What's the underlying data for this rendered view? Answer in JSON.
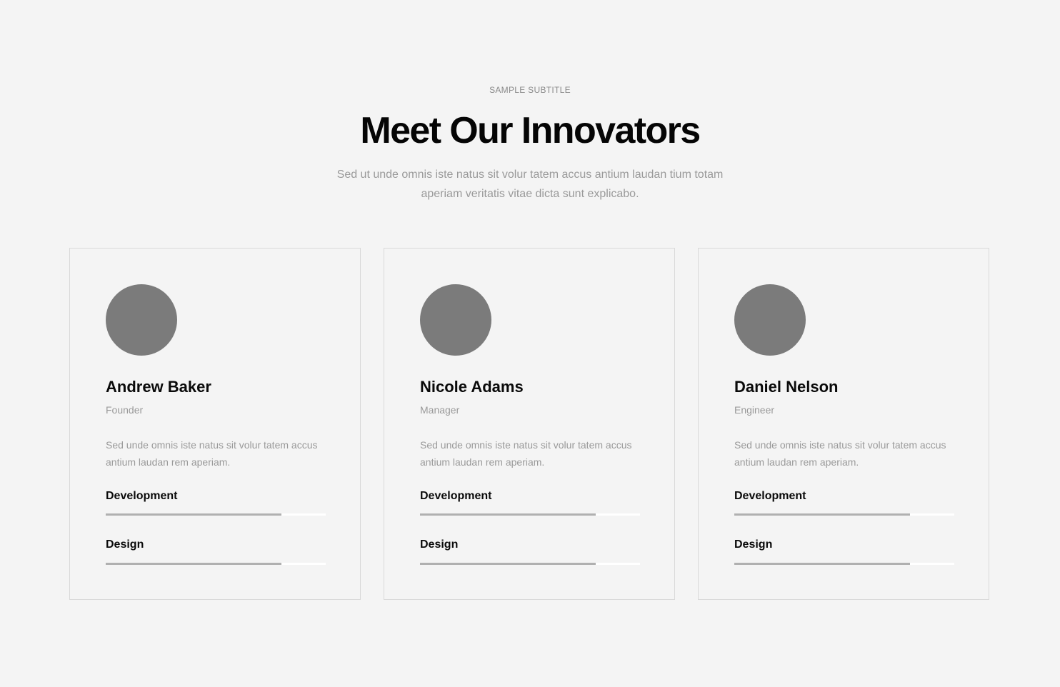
{
  "section": {
    "subtitle": "SAMPLE SUBTITLE",
    "title": "Meet Our Innovators",
    "intro": "Sed ut unde omnis iste natus sit volur tatem accus antium laudan tium totam aperiam veritatis vitae dicta sunt explicabo."
  },
  "colors": {
    "background": "#f4f4f4",
    "avatar": "#7b7b7b",
    "skill_fill": "#b0b0b0",
    "skill_track": "#ffffff"
  },
  "team": [
    {
      "name": "Andrew Baker",
      "role": "Founder",
      "bio": "Sed unde omnis iste natus sit volur tatem accus antium laudan rem aperiam.",
      "skills": [
        {
          "label": "Development",
          "level": 0.8
        },
        {
          "label": "Design",
          "level": 0.8
        }
      ]
    },
    {
      "name": "Nicole Adams",
      "role": "Manager",
      "bio": "Sed unde omnis iste natus sit volur tatem accus antium laudan rem aperiam.",
      "skills": [
        {
          "label": "Development",
          "level": 0.8
        },
        {
          "label": "Design",
          "level": 0.8
        }
      ]
    },
    {
      "name": "Daniel Nelson",
      "role": "Engineer",
      "bio": "Sed unde omnis iste natus sit volur tatem accus antium laudan rem aperiam.",
      "skills": [
        {
          "label": "Development",
          "level": 0.8
        },
        {
          "label": "Design",
          "level": 0.8
        }
      ]
    }
  ]
}
